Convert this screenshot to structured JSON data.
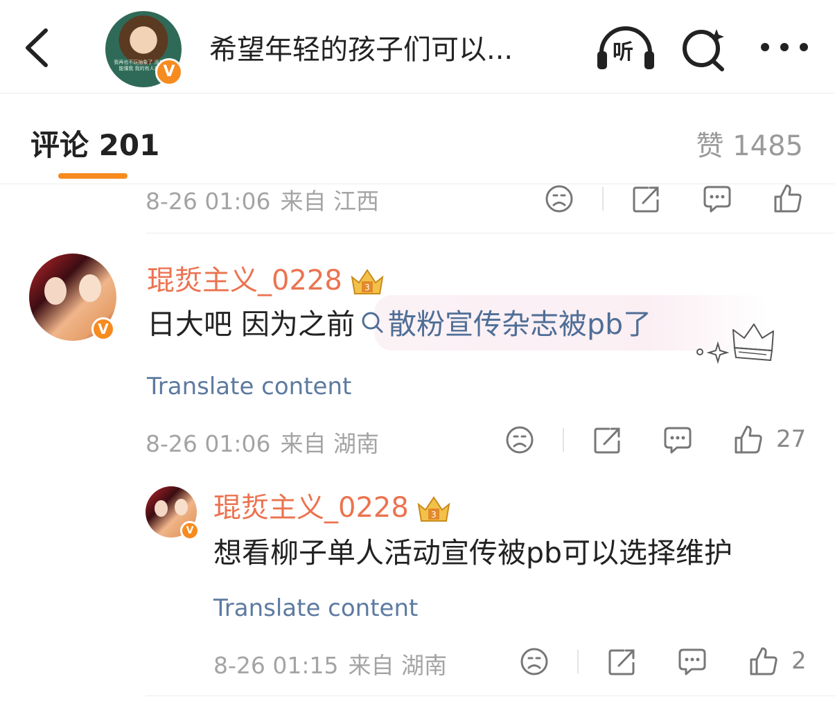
{
  "header": {
    "title": "希望年轻的孩子们可以...",
    "avatar_caption": "我再也不玩抽象了 没有人能懂我 我的有人担我",
    "verified_mark": "V",
    "listen_label": "听"
  },
  "tabs": {
    "comments_label": "评论 201",
    "likes_label": "赞 1485"
  },
  "prev_comment": {
    "time": "8-26 01:06",
    "source": "来自 江西"
  },
  "comments": [
    {
      "username": "琨烲主义_0228",
      "verified_mark": "V",
      "text_before": "日大吧  因为之前",
      "topic": "散粉宣传杂志被pb了",
      "translate_label": "Translate content",
      "time": "8-26 01:06",
      "source": "来自 湖南",
      "like_count": "27"
    },
    {
      "username": "琨烲主义_0228",
      "verified_mark": "V",
      "text": "想看柳子单人活动宣传被pb可以选择维护",
      "translate_label": "Translate content",
      "time": "8-26 01:15",
      "source": "来自 湖南",
      "like_count": "2"
    }
  ],
  "colors": {
    "accent": "#f68b1f",
    "username": "#eb7350",
    "link": "#4f6e96",
    "meta": "#a4a4a4"
  },
  "icons": [
    "back-icon",
    "listen-icon",
    "search-icon",
    "more-icon",
    "dislike-icon",
    "share-icon",
    "reply-icon",
    "like-icon",
    "crown-badge-icon",
    "search-topic-icon",
    "sparkle-crown-icon"
  ]
}
